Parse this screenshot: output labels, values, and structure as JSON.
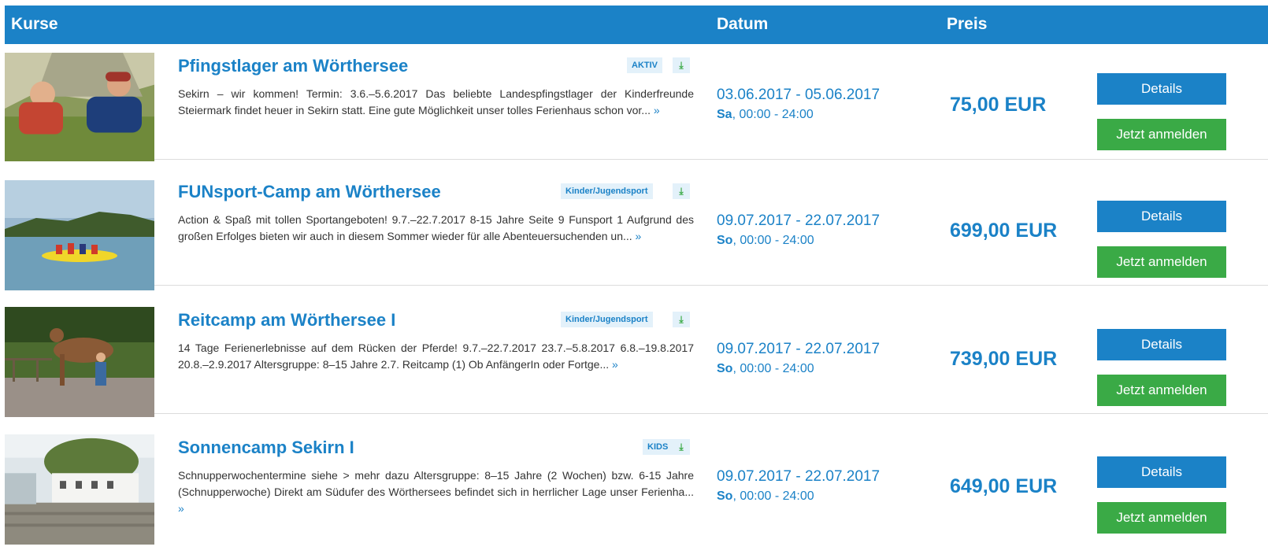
{
  "header": {
    "courses": "Kurse",
    "date": "Datum",
    "price": "Preis"
  },
  "colors": {
    "primary": "#1b82c7",
    "success": "#3aaa46",
    "tag_bg": "#e3f1fa"
  },
  "courses": [
    {
      "title": "Pfingstlager am Wörthersee",
      "tag": "AKTIV",
      "download_icon": "download-icon",
      "description": "Sekirn – wir kommen! Termin: 3.6.–5.6.2017 Das beliebte Landespfingstlager der Kinderfreunde Steiermark findet heuer in Sekirn statt. Eine gute Möglichkeit unser tolles Ferienhaus schon vor...",
      "more": "»",
      "date_range": "03.06.2017 - 05.06.2017",
      "weekday": "Sa",
      "time": ", 00:00 - 24:00",
      "price": "75,00 EUR",
      "details_label": "Details",
      "signup_label": "Jetzt anmelden"
    },
    {
      "title": "FUNsport-Camp am Wörthersee",
      "tag": "Kinder/Jugendsport",
      "download_icon": "download-icon",
      "description": "Action & Spaß mit tollen Sportangeboten! 9.7.–22.7.2017 8-15 Jahre Seite 9 Funsport 1 Aufgrund des großen Erfolges bieten wir auch in diesem Sommer wieder für alle Abenteuersuchenden un...",
      "more": "»",
      "date_range": "09.07.2017 - 22.07.2017",
      "weekday": "So",
      "time": ", 00:00 - 24:00",
      "price": "699,00 EUR",
      "details_label": "Details",
      "signup_label": "Jetzt anmelden"
    },
    {
      "title": "Reitcamp am Wörthersee I",
      "tag": "Kinder/Jugendsport",
      "download_icon": "download-icon",
      "description": "14 Tage Ferienerlebnisse auf dem Rücken der Pferde! 9.7.–22.7.2017 23.7.–5.8.2017 6.8.–19.8.2017 20.8.–2.9.2017 Altersgruppe: 8–15 Jahre 2.7. Reitcamp (1) Ob AnfängerIn oder Fortge...",
      "more": "»",
      "date_range": "09.07.2017 - 22.07.2017",
      "weekday": "So",
      "time": ", 00:00 - 24:00",
      "price": "739,00 EUR",
      "details_label": "Details",
      "signup_label": "Jetzt anmelden"
    },
    {
      "title": "Sonnencamp Sekirn I",
      "tag": "KIDS",
      "download_icon": "download-icon",
      "description": "Schnupperwochentermine siehe > mehr dazu Altersgruppe: 8–15 Jahre (2 Wochen) bzw. 6-15 Jahre (Schnupperwoche) Direkt am Südufer des Wörthersees befindet sich in herrlicher Lage unser Ferienha...",
      "more": "»",
      "date_range": "09.07.2017 - 22.07.2017",
      "weekday": "So",
      "time": ", 00:00 - 24:00",
      "price": "649,00 EUR",
      "details_label": "Details",
      "signup_label": "Jetzt anmelden"
    }
  ]
}
